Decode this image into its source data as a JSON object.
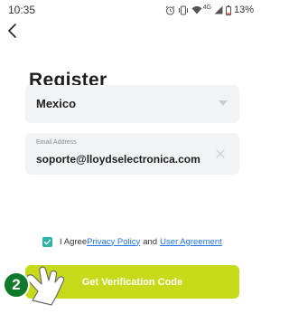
{
  "status_bar": {
    "time": "10:35",
    "network": "4G",
    "battery": "13%",
    "icons": [
      "alarm-icon",
      "vibrate-icon",
      "wifi-icon",
      "signal-icon",
      "battery-icon"
    ]
  },
  "nav": {
    "back_icon": "chevron-left-icon"
  },
  "page": {
    "title": "Register"
  },
  "country": {
    "selected": "Mexico",
    "icon": "caret-down-icon"
  },
  "email": {
    "label": "Email Address",
    "value": "soporte@lloydselectronica.com",
    "clear_icon": "close-icon"
  },
  "agreement": {
    "checked": true,
    "prefix": "I Agree",
    "privacy_link": "Privacy Policy",
    "conjunction": "and",
    "user_agreement_link": "User Agreement"
  },
  "primary_button": {
    "label": "Get Verification Code"
  },
  "step_badge": {
    "number": "2"
  },
  "colors": {
    "accent": "#c7da1a",
    "checkbox": "#2bb3a7",
    "link": "#1e73e8",
    "field_bg": "#f2f3f5",
    "badge": "#0f7a2b"
  }
}
